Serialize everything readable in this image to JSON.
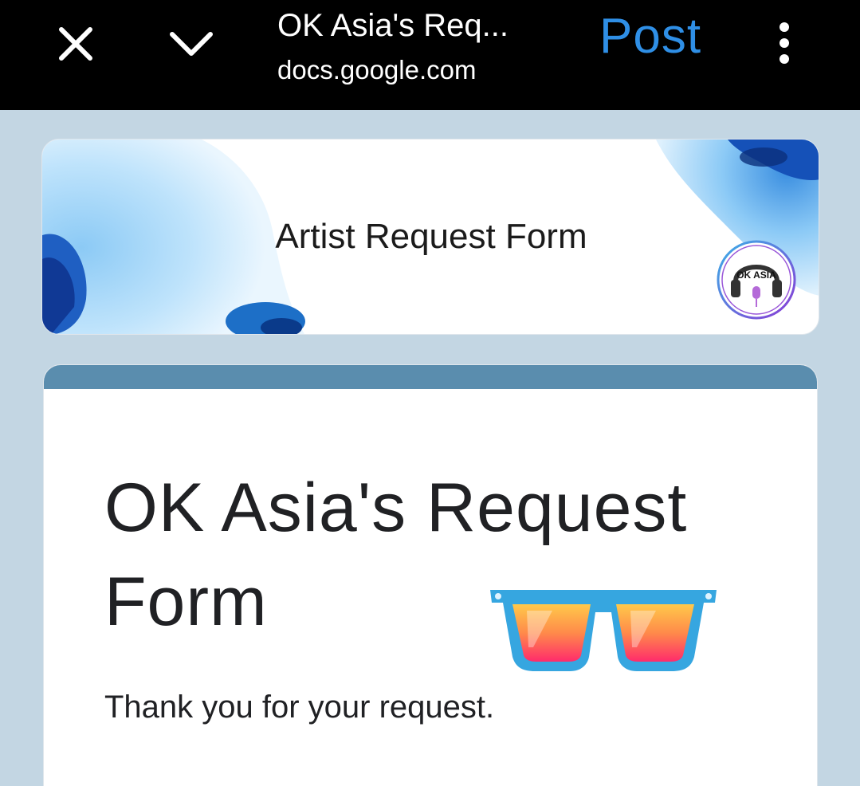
{
  "topbar": {
    "title": "OK Asia's Req...",
    "url": "docs.google.com",
    "post_label": "Post"
  },
  "header_card": {
    "title": "Artist Request Form",
    "logo_text": "OK ASIA"
  },
  "form": {
    "title": "OK Asia's Request Form",
    "description": "Thank you for your request."
  },
  "colors": {
    "topbar_bg": "#000000",
    "accent_blue": "#2f8fe6",
    "page_bg": "#c3d6e3",
    "card_accent": "#5a8dae"
  },
  "icons": {
    "close": "close-icon",
    "collapse": "chevron-down-icon",
    "menu": "more-vert-icon",
    "glasses": "sunglasses-emoji"
  }
}
